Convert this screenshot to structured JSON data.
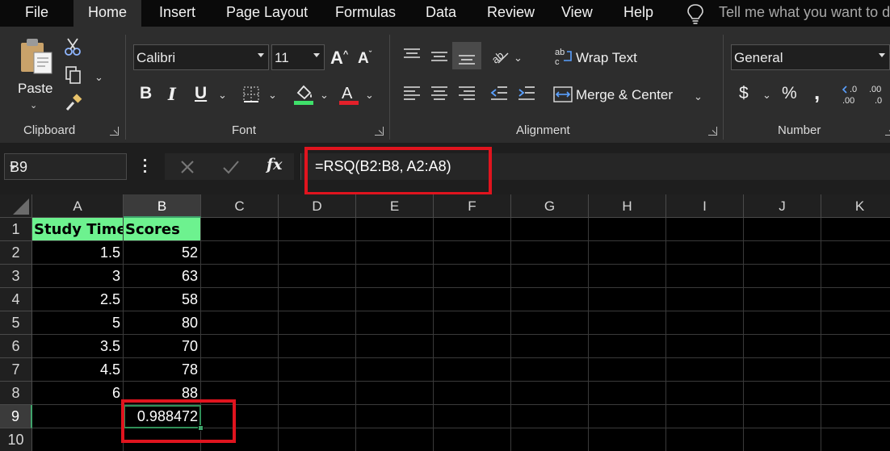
{
  "menu": {
    "tabs": [
      "File",
      "Home",
      "Insert",
      "Page Layout",
      "Formulas",
      "Data",
      "Review",
      "View",
      "Help"
    ],
    "active": "Home",
    "tell_me": "Tell me what you want to do"
  },
  "ribbon": {
    "clipboard": {
      "paste_label": "Paste",
      "group_label": "Clipboard"
    },
    "font": {
      "font_name": "Calibri",
      "font_size": "11",
      "group_label": "Font",
      "bold": "B",
      "italic": "I",
      "underline": "U",
      "fill_color": "#3fe06a",
      "font_color": "#e3202a"
    },
    "alignment": {
      "wrap_text": "Wrap Text",
      "merge_center": "Merge & Center",
      "group_label": "Alignment"
    },
    "number": {
      "format": "General",
      "currency": "$",
      "percent": "%",
      "comma": ",",
      "group_label": "Number"
    }
  },
  "formula_bar": {
    "name_box": "B9",
    "fx": "fx",
    "formula": "=RSQ(B2:B8, A2:A8)"
  },
  "grid": {
    "columns": [
      "A",
      "B",
      "C",
      "D",
      "E",
      "F",
      "G",
      "H",
      "I",
      "J",
      "K"
    ],
    "rows": [
      "1",
      "2",
      "3",
      "4",
      "5",
      "6",
      "7",
      "8",
      "9",
      "10"
    ],
    "selected_column": "B",
    "selected_row": "9",
    "header_fill": "#6df28f",
    "cells": {
      "A1": "Study Time",
      "B1": "Scores",
      "A2": "1.5",
      "B2": "52",
      "A3": "3",
      "B3": "63",
      "A4": "2.5",
      "B4": "58",
      "A5": "5",
      "B5": "80",
      "A6": "3.5",
      "B6": "70",
      "A7": "4.5",
      "B7": "78",
      "A8": "6",
      "B8": "88",
      "B9": "0.988472"
    }
  }
}
